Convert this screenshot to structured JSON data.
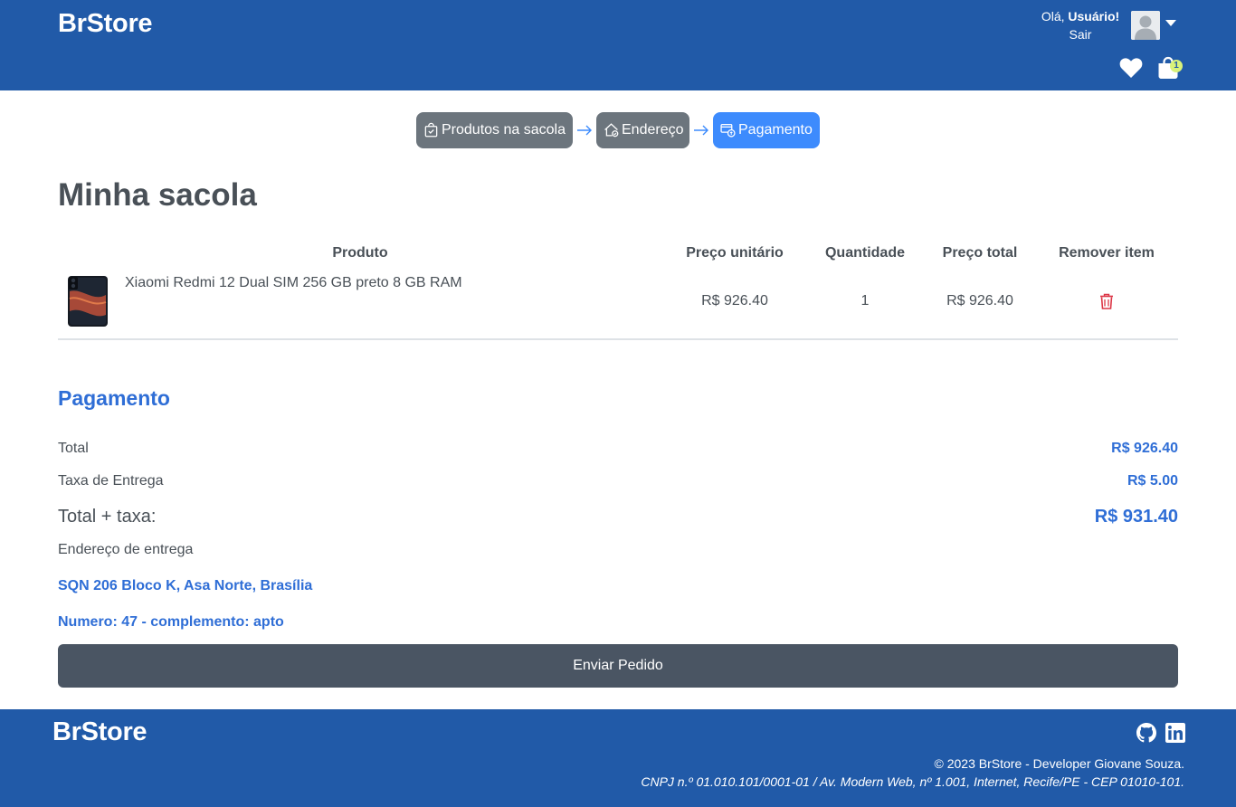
{
  "header": {
    "brand": "BrStore",
    "greeting_prefix": "Olá,",
    "greeting_user": "Usuário!",
    "logout": "Sair",
    "cart_count": "1",
    "icons": [
      "user-avatar",
      "caret-down-icon",
      "heart-icon",
      "shopping-bag-icon"
    ]
  },
  "steps": [
    {
      "label": "Produtos na sacola",
      "icon": "bag-check-icon",
      "state": "done"
    },
    {
      "label": "Endereço",
      "icon": "house-icon",
      "state": "done"
    },
    {
      "label": "Pagamento",
      "icon": "payment-icon",
      "state": "active"
    }
  ],
  "main": {
    "title": "Minha sacola",
    "table": {
      "columns": [
        "Produto",
        "Preço unitário",
        "Quantidade",
        "Preço total",
        "Remover item"
      ],
      "rows": [
        {
          "product": "Xiaomi Redmi 12 Dual SIM 256 GB preto 8 GB RAM",
          "unit_price": "R$ 926.40",
          "quantity": "1",
          "total_price": "R$ 926.40"
        }
      ]
    }
  },
  "payment": {
    "title": "Pagamento",
    "total_label": "Total",
    "total_value": "R$ 926.40",
    "fee_label": "Taxa de Entrega",
    "fee_value": "R$ 5.00",
    "grand_label": "Total + taxa:",
    "grand_value": "R$ 931.40",
    "address_label": "Endereço de entrega",
    "address_line1": "SQN 206 Bloco K, Asa Norte, Brasília",
    "address_line2": "Numero: 47 - complemento: apto",
    "submit": "Enviar Pedido"
  },
  "footer": {
    "brand": "BrStore",
    "copyright": "© 2023 BrStore - Developer Giovane Souza.",
    "company": "CNPJ n.º 01.010.101/0001-01 / Av. Modern Web, nº 1.001, Internet, Recife/PE - CEP 01010-101.",
    "icons": [
      "github-icon",
      "linkedin-icon"
    ]
  },
  "colors": {
    "brand_blue": "#215aa8",
    "accent_blue": "#2f6ed6",
    "active_step": "#3d8bfd",
    "done_step": "#6c757d",
    "danger": "#dc3545",
    "button_dark": "#4a5563"
  }
}
